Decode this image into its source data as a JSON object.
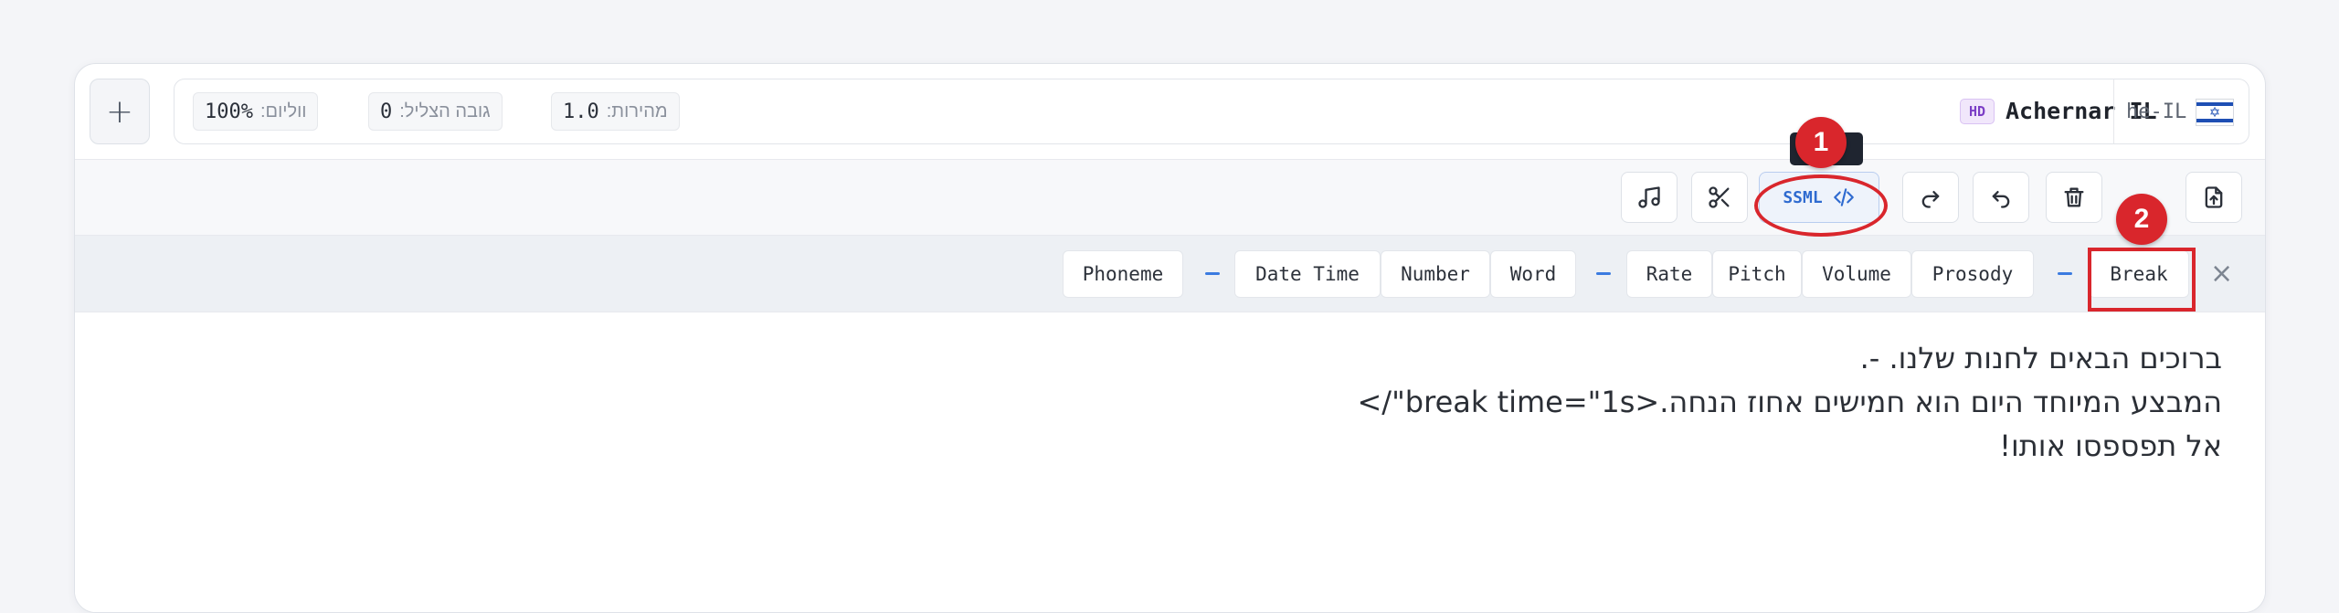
{
  "topbar": {
    "add_label": "+",
    "volume": {
      "label": "ווליום:",
      "value": "100%"
    },
    "pitch": {
      "label": "גובה הצליל:",
      "value": "0"
    },
    "rate": {
      "label": "מהירות:",
      "value": "1.0"
    },
    "hd_badge": "HD",
    "voice_name": "Achernar IL",
    "language_code": "he-IL",
    "flag_icon": "israel-flag-icon"
  },
  "toolbar": {
    "ssml_label": "SSML",
    "tooltip_text": "",
    "icons": [
      "music-note-icon",
      "scissors-icon",
      "code-icon",
      "redo-icon",
      "undo-icon",
      "trash-icon",
      "blank",
      "export-icon"
    ]
  },
  "tags": {
    "phoneme": "Phoneme",
    "date_time": "Date Time",
    "number": "Number",
    "word": "Word",
    "rate": "Rate",
    "pitch": "Pitch",
    "volume": "Volume",
    "prosody": "Prosody",
    "break": "Break",
    "close": "×"
  },
  "editor": {
    "lines": [
      "ברוכים הבאים לחנות שלנו. -.",
      "המבצע המיוחד היום הוא חמישים אחוז הנחה.<break time=\"1s\"/>",
      "אל תפספסו אותו!"
    ]
  },
  "annotations": {
    "marker_1": "1",
    "marker_2": "2"
  },
  "colors": {
    "accent": "#2f6bd0",
    "marker": "#d9262c",
    "hd": "#7c3fc6"
  }
}
